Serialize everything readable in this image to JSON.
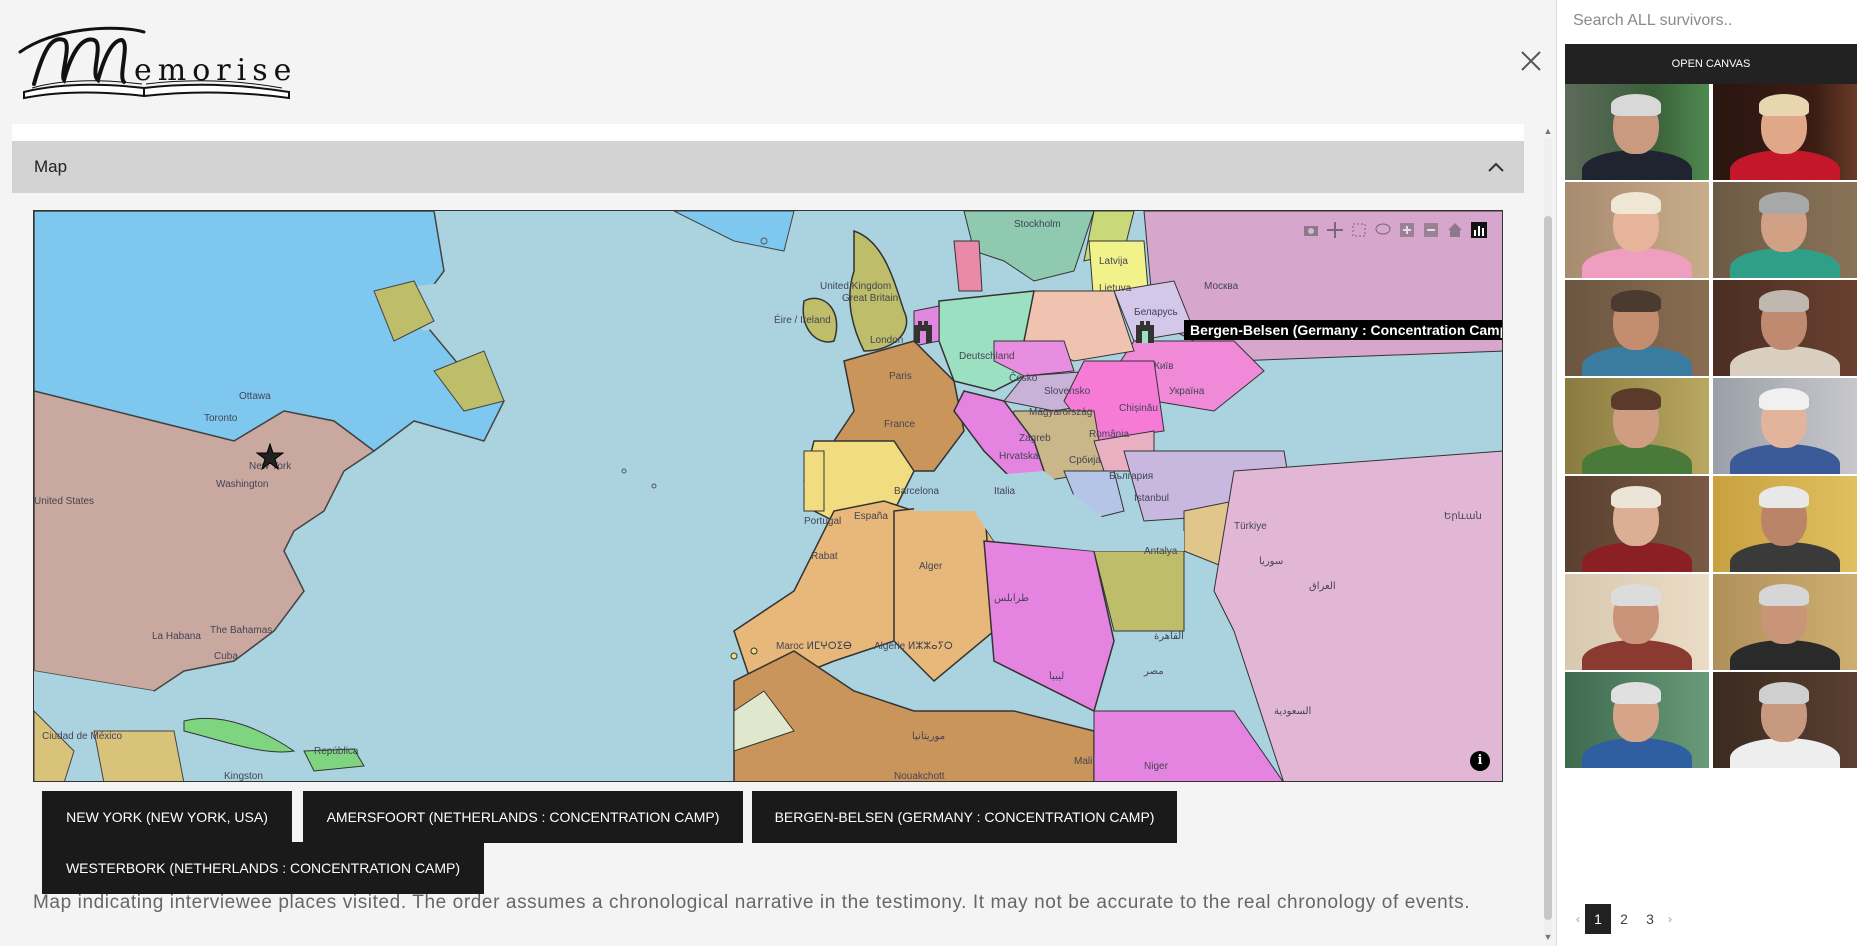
{
  "app": {
    "logo_text": "Memorise",
    "close_icon": "close-icon"
  },
  "section": {
    "title": "Map",
    "toggle_icon": "chevron-up-icon"
  },
  "map": {
    "tooltip": "Bergen-Belsen (Germany : Concentration Camp)",
    "info_label": "i",
    "labels": {
      "ottawa": "Ottawa",
      "toronto": "Toronto",
      "new_york": "New York",
      "washington": "Washington",
      "united_states": "United States",
      "the_bahamas": "The Bahamas",
      "la_habana": "La Habana",
      "cuba": "Cuba",
      "kingston": "Kingston",
      "ciudad_de_mexico": "Ciudad de México",
      "republica": "República",
      "united_kingdom": "United Kingdom",
      "great_britain": "Great Britain",
      "eire": "Éire / Ireland",
      "london": "London",
      "paris": "Paris",
      "france": "France",
      "deutschland": "Deutschland",
      "cesko": "Česko",
      "slovensko": "Slovensko",
      "magyarorszag": "Magyarország",
      "romania": "România",
      "ukraina": "Україна",
      "moskva": "Москва",
      "latvija": "Latvija",
      "lietuva": "Lietuva",
      "belarus": "Беларусь",
      "kyiv": "Київ",
      "chisinau": "Chișinău",
      "stockholm": "Stockholm",
      "hrvatska": "Hrvatska",
      "zagreb": "Zagreb",
      "srbija": "Србија",
      "bulgaria": "България",
      "italia": "Italia",
      "barcelona": "Barcelona",
      "espana": "España",
      "portugal": "Portugal",
      "rabat": "Rabat",
      "alger": "Alger",
      "algerie": "Algérie ⵍⵣⵣⴰⵢⵔ",
      "maroc": "Maroc ⵍⵎⵖⵔⵉⴱ",
      "tarabulus": "طرابلس",
      "libya": "ليبيا",
      "misr": "مصر",
      "al_qahira": "القاهرة",
      "turkiye": "Türkiye",
      "antalya": "Antalya",
      "istanbul": "İstanbul",
      "suriya": "سوريا",
      "iraq": "العراق",
      "saudi": "السعودية",
      "mali": "Mali",
      "niger": "Niger",
      "mauritanie": "موريتانيا",
      "nouakchott": "Nouakchott",
      "yerevan": "Երևան"
    }
  },
  "places": [
    "NEW YORK (NEW YORK, USA)",
    "AMERSFOORT (NETHERLANDS : CONCENTRATION CAMP)",
    "BERGEN-BELSEN (GERMANY : CONCENTRATION CAMP)",
    "WESTERBORK (NETHERLANDS : CONCENTRATION CAMP)"
  ],
  "caption": "Map indicating interviewee places visited. The order assumes a chronological narrative in the testimony. It may not be accurate to the real chronology of events.",
  "sidebar": {
    "search_placeholder": "Search ALL survivors..",
    "open_canvas": "OPEN CANVAS",
    "pagination": {
      "prev": "‹",
      "pages": [
        "1",
        "2",
        "3"
      ],
      "next": "›",
      "current": "1"
    }
  },
  "colors": {
    "ocean": "#aad3df",
    "button_bg": "#1a1a1a",
    "header_bg": "#d3d3d3"
  }
}
